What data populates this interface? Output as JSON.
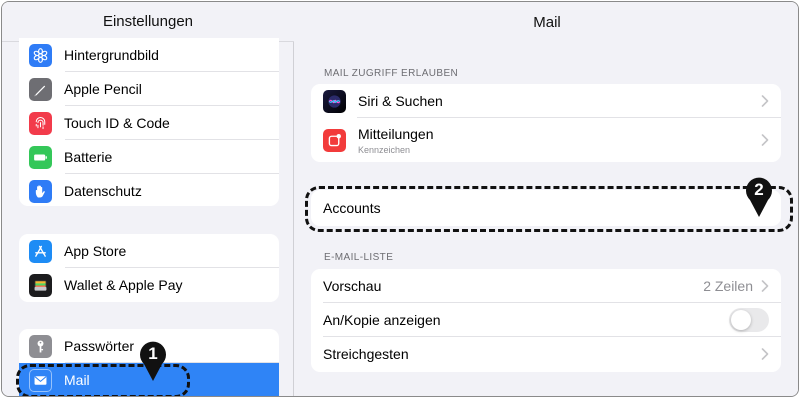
{
  "sidebar": {
    "title": "Einstellungen",
    "items": [
      {
        "label": "Hintergrundbild",
        "icon": "wallpaper-icon",
        "color": "#2f7cf6"
      },
      {
        "label": "Apple Pencil",
        "icon": "pencil-icon",
        "color": "#6e6e73"
      },
      {
        "label": "Touch ID & Code",
        "icon": "fingerprint-icon",
        "color": "#f23b4b"
      },
      {
        "label": "Batterie",
        "icon": "battery-icon",
        "color": "#34c759"
      },
      {
        "label": "Datenschutz",
        "icon": "hand-icon",
        "color": "#2f7cf6"
      },
      {
        "label": "App Store",
        "icon": "app-store-icon",
        "color": "#1e8cf5"
      },
      {
        "label": "Wallet & Apple Pay",
        "icon": "wallet-icon",
        "color": "#1c1c1e"
      },
      {
        "label": "Passwörter",
        "icon": "key-icon",
        "color": "#8e8e93"
      },
      {
        "label": "Mail",
        "icon": "mail-icon",
        "color": "#2f84f6",
        "selected": true
      }
    ]
  },
  "main": {
    "title": "Mail",
    "section_access": "MAIL ZUGRIFF ERLAUBEN",
    "access_rows": [
      {
        "label": "Siri & Suchen",
        "icon": "siri-icon"
      },
      {
        "label": "Mitteilungen",
        "sublabel": "Kennzeichen",
        "icon": "notifications-icon"
      }
    ],
    "accounts_label": "Accounts",
    "section_list": "E-MAIL-LISTE",
    "list_rows": [
      {
        "label": "Vorschau",
        "value": "2 Zeilen"
      },
      {
        "label": "An/Kopie anzeigen",
        "toggle": false
      },
      {
        "label": "Streichgesten"
      }
    ]
  },
  "callouts": {
    "one": "1",
    "two": "2"
  },
  "colors": {
    "accent": "#2f84f6",
    "background": "#f2f2f7"
  }
}
